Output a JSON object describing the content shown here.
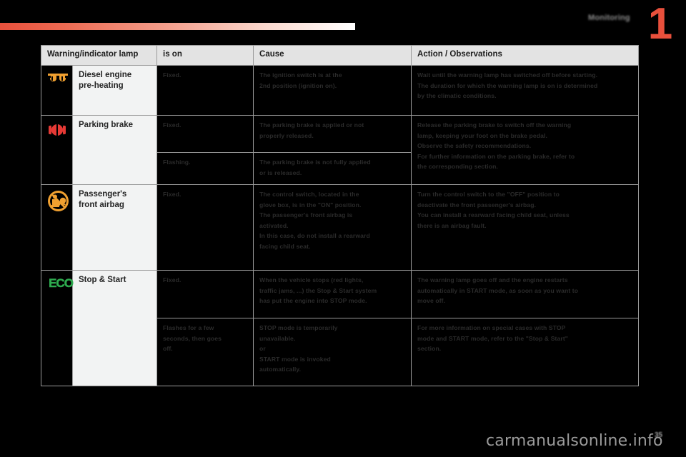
{
  "header": {
    "chapter_label": "Monitoring",
    "chapter_number": "1"
  },
  "table": {
    "columns": [
      "Warning/indicator lamp",
      "is on",
      "Cause",
      "Action / Observations"
    ],
    "rows": [
      {
        "icon": "diesel-preheat-icon",
        "name": "Diesel engine\npre-heating",
        "name_line1": "Diesel engine",
        "name_line2": "pre-heating",
        "subrows": [
          {
            "is_on": [
              "Fixed."
            ],
            "cause": [
              "The ignition switch is at the",
              "2nd position (ignition on)."
            ],
            "action": [
              "Wait until the warning lamp has switched off before starting.",
              "The duration for which the warning lamp is on is determined",
              "by the climatic conditions."
            ]
          }
        ]
      },
      {
        "icon": "parking-brake-icon",
        "name": "Parking brake",
        "name_line1": "Parking brake",
        "name_line2": "",
        "subrows": [
          {
            "is_on": [
              "Fixed."
            ],
            "cause": [
              "The parking brake is applied or not",
              "properly released."
            ],
            "action": [
              "Release the parking brake to switch off the warning",
              "lamp, keeping your foot on the brake pedal.",
              "Observe the safety recommendations.",
              "For further information on the parking brake, refer to",
              "the corresponding section."
            ]
          },
          {
            "is_on": [
              "Flashing."
            ],
            "cause": [
              "The parking brake is not fully applied",
              "or is released."
            ],
            "action": []
          }
        ]
      },
      {
        "icon": "passenger-airbag-off-icon",
        "name": "Passenger's\nfront airbag",
        "name_line1": "Passenger's",
        "name_line2": "front airbag",
        "subrows": [
          {
            "is_on": [
              "Fixed."
            ],
            "cause": [
              "The control switch, located in the",
              "glove box, is in the \"ON\" position.",
              "The passenger's front airbag is",
              "activated.",
              "In this case, do not install a rearward",
              "facing child seat."
            ],
            "action": [
              "Turn the control switch to the \"OFF\" position to",
              "deactivate the front passenger's airbag.",
              "You can install a rearward facing child seat, unless",
              "there is an airbag fault."
            ]
          }
        ]
      },
      {
        "icon": "eco-stop-start-icon",
        "name": "Stop & Start",
        "name_line1": "Stop & Start",
        "name_line2": "",
        "subrows": [
          {
            "is_on": [
              "Fixed."
            ],
            "cause": [
              "When the vehicle stops (red lights,",
              "traffic jams, ...) the Stop & Start system",
              "has put the engine into STOP mode."
            ],
            "action": [
              "The warning lamp goes off and the engine restarts",
              "automatically in START mode, as soon as you want to",
              "move off."
            ]
          },
          {
            "is_on": [
              "Flashes for a few",
              "seconds, then goes",
              "off."
            ],
            "cause": [
              "STOP mode is temporarily",
              "unavailable.",
              "or",
              "START mode is invoked",
              "automatically."
            ],
            "action": [
              "For more information on special cases with STOP",
              "mode and START mode, refer to the \"Stop & Start\"",
              "section."
            ]
          }
        ]
      }
    ]
  },
  "footer": {
    "watermark": "carmanualsonline.info",
    "page_number": "35"
  },
  "colors": {
    "accent_red": "#e8503c",
    "icon_amber": "#f0a030",
    "icon_red": "#e53935",
    "icon_green": "#2eab4f",
    "header_bg": "#e3e3e3",
    "name_bg": "#f2f3f3"
  }
}
